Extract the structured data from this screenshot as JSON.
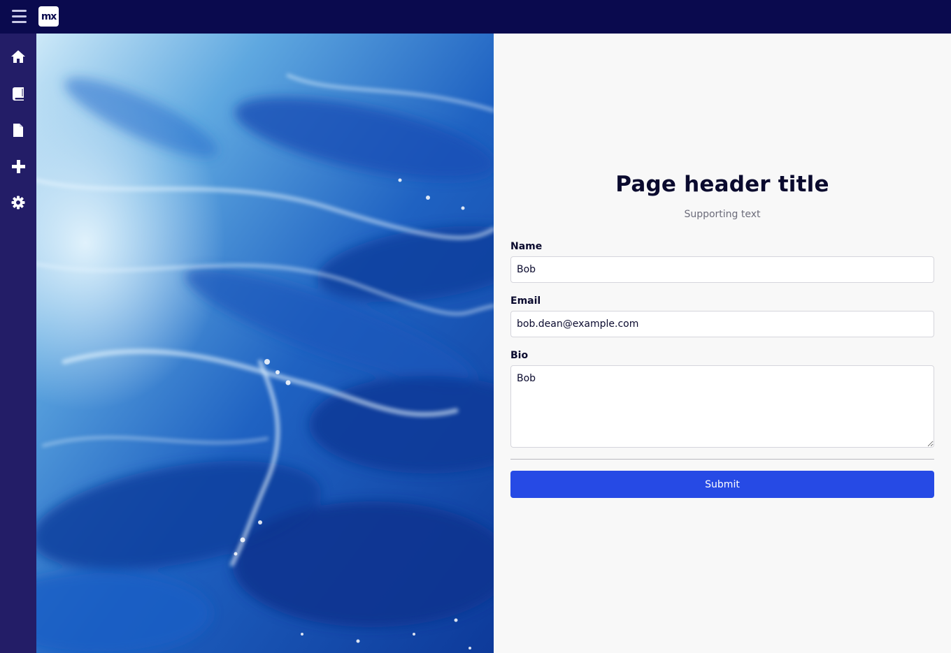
{
  "app": {
    "logo_text": "mx"
  },
  "nav": {
    "items": [
      {
        "icon": "home-icon"
      },
      {
        "icon": "book-icon"
      },
      {
        "icon": "file-icon"
      },
      {
        "icon": "plus-icon"
      },
      {
        "icon": "gear-icon"
      }
    ]
  },
  "page": {
    "title": "Page header title",
    "subtitle": "Supporting text"
  },
  "form": {
    "name_label": "Name",
    "name_value": "Bob",
    "email_label": "Email",
    "email_value": "bob.dean@example.com",
    "bio_label": "Bio",
    "bio_value": "Bob",
    "submit_label": "Submit"
  },
  "colors": {
    "topbar": "#0a0a4e",
    "sidebar": "#231d67",
    "primary": "#264ae5",
    "content_background": "#f8f8f8"
  }
}
